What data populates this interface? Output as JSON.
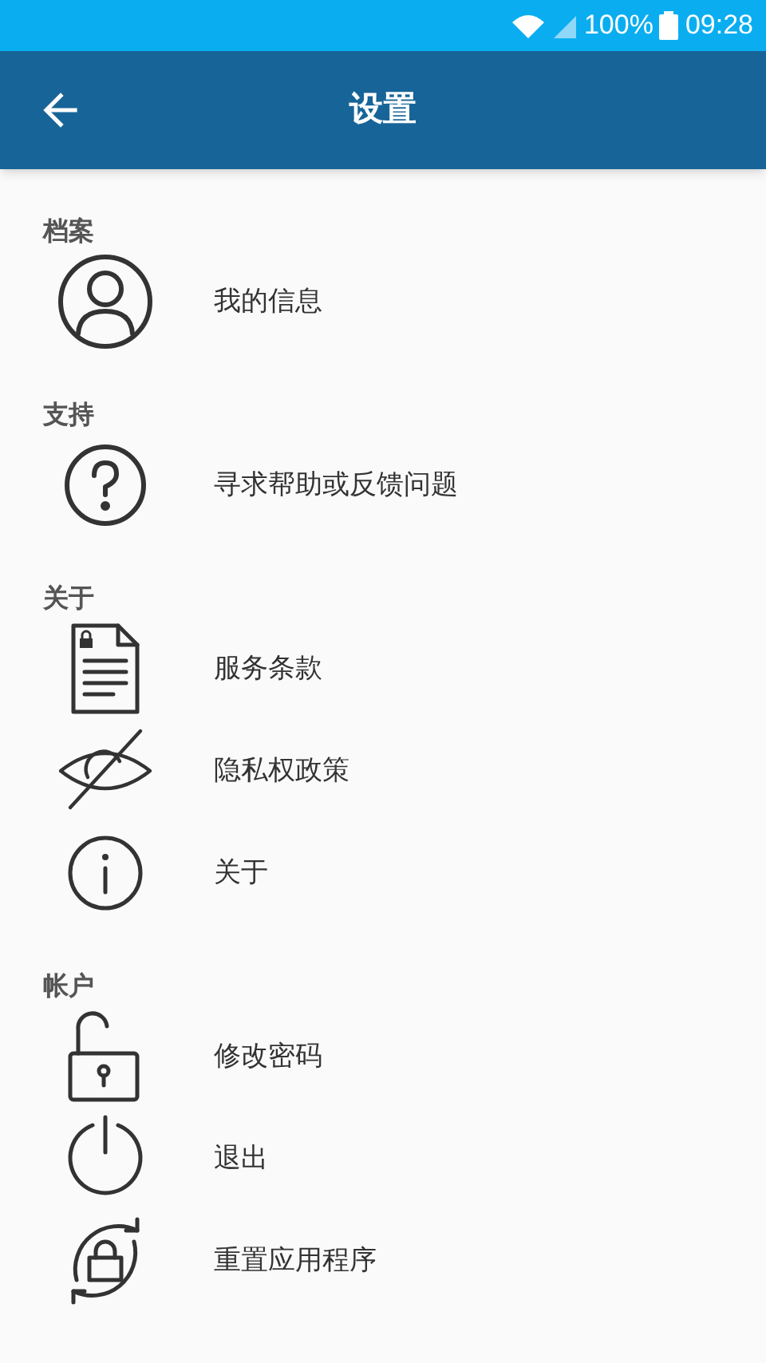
{
  "status_bar": {
    "battery": "100%",
    "time": "09:28"
  },
  "app_bar": {
    "title": "设置"
  },
  "sections": [
    {
      "header": "档案",
      "items": [
        {
          "kind": "person",
          "label": "我的信息"
        }
      ]
    },
    {
      "header": "支持",
      "items": [
        {
          "kind": "help",
          "label": "寻求帮助或反馈问题"
        }
      ]
    },
    {
      "header": "关于",
      "items": [
        {
          "kind": "document",
          "label": "服务条款"
        },
        {
          "kind": "privacy",
          "label": "隐私权政策"
        },
        {
          "kind": "info",
          "label": "关于"
        }
      ]
    },
    {
      "header": "帐户",
      "items": [
        {
          "kind": "unlock",
          "label": "修改密码"
        },
        {
          "kind": "power",
          "label": "退出"
        },
        {
          "kind": "reset",
          "label": "重置应用程序"
        }
      ]
    }
  ]
}
